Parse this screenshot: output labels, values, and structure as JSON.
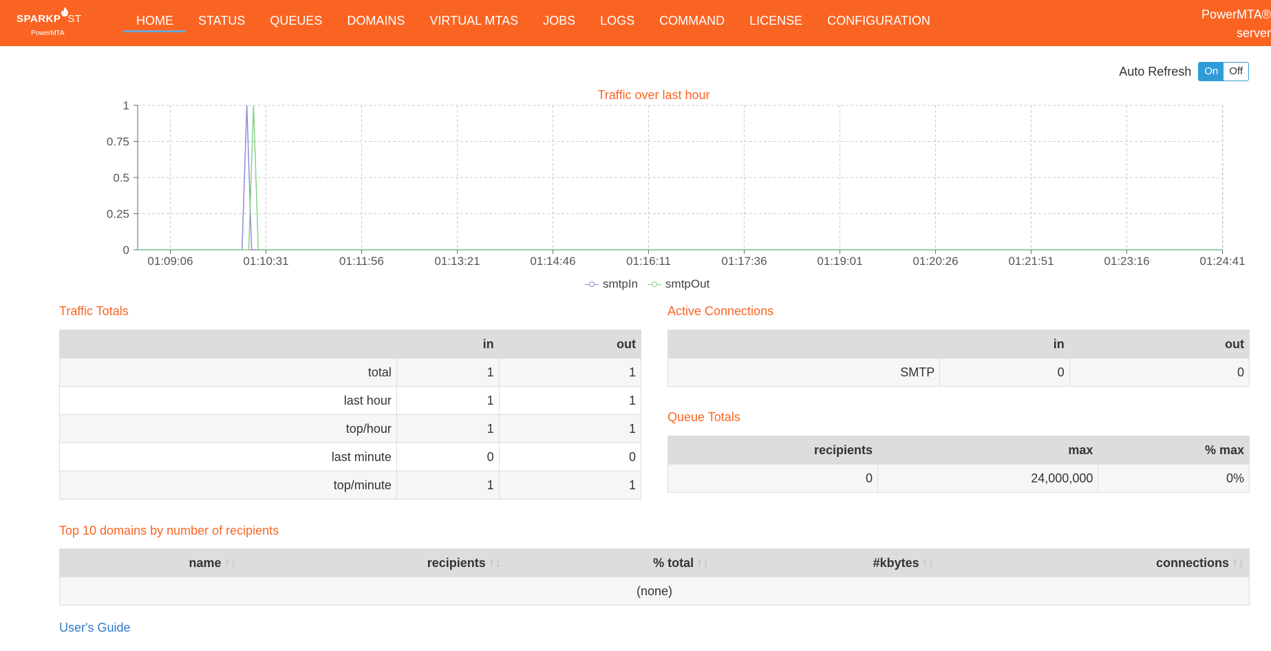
{
  "brand": {
    "logo_main_bold": "SPARKP",
    "logo_main_thin": "ST",
    "logo_sub": "PowerMTA"
  },
  "nav": {
    "items": [
      "HOME",
      "STATUS",
      "QUEUES",
      "DOMAINS",
      "VIRTUAL MTAS",
      "JOBS",
      "LOGS",
      "COMMAND",
      "LICENSE",
      "CONFIGURATION"
    ],
    "active": "HOME",
    "right_line1": "PowerMTA®",
    "right_line2": "server"
  },
  "auto_refresh": {
    "label": "Auto Refresh",
    "on": "On",
    "off": "Off",
    "state": "On"
  },
  "chart_data": {
    "type": "line",
    "title": "Traffic over last hour",
    "x": [
      "01:09:06",
      "01:10:31",
      "01:11:56",
      "01:13:21",
      "01:14:46",
      "01:16:11",
      "01:17:36",
      "01:19:01",
      "01:20:26",
      "01:21:51",
      "01:23:16",
      "01:24:41"
    ],
    "ylim": [
      0,
      1
    ],
    "yticks": [
      0,
      0.25,
      0.5,
      0.75,
      1
    ],
    "series": [
      {
        "name": "smtpIn",
        "color": "#8c8cd9",
        "points": [
          [
            -0.5,
            0
          ],
          [
            0.7,
            0
          ],
          [
            0.75,
            0
          ],
          [
            0.8,
            1
          ],
          [
            0.85,
            0
          ],
          [
            11,
            0
          ]
        ]
      },
      {
        "name": "smtpOut",
        "color": "#86d18a",
        "points": [
          [
            -0.5,
            0
          ],
          [
            0.77,
            0
          ],
          [
            0.82,
            0
          ],
          [
            0.87,
            1
          ],
          [
            0.92,
            0
          ],
          [
            11,
            0
          ]
        ]
      }
    ],
    "grid": true,
    "legend": "bottom-center"
  },
  "traffic_totals": {
    "title": "Traffic Totals",
    "headers": [
      "",
      "in",
      "out"
    ],
    "rows": [
      [
        "total",
        "1",
        "1"
      ],
      [
        "last hour",
        "1",
        "1"
      ],
      [
        "top/hour",
        "1",
        "1"
      ],
      [
        "last minute",
        "0",
        "0"
      ],
      [
        "top/minute",
        "1",
        "1"
      ]
    ]
  },
  "active_connections": {
    "title": "Active Connections",
    "headers": [
      "",
      "in",
      "out"
    ],
    "rows": [
      [
        "SMTP",
        "0",
        "0"
      ]
    ]
  },
  "queue_totals": {
    "title": "Queue Totals",
    "headers": [
      "recipients",
      "max",
      "% max"
    ],
    "rows": [
      [
        "0",
        "24,000,000",
        "0%"
      ]
    ]
  },
  "top_domains": {
    "title": "Top 10 domains by number of recipients",
    "headers": [
      "name",
      "recipients",
      "% total",
      "#kbytes",
      "connections"
    ],
    "sort_icon": "↑↓",
    "empty": "(none)"
  },
  "footer": {
    "users_guide": "User's Guide"
  }
}
